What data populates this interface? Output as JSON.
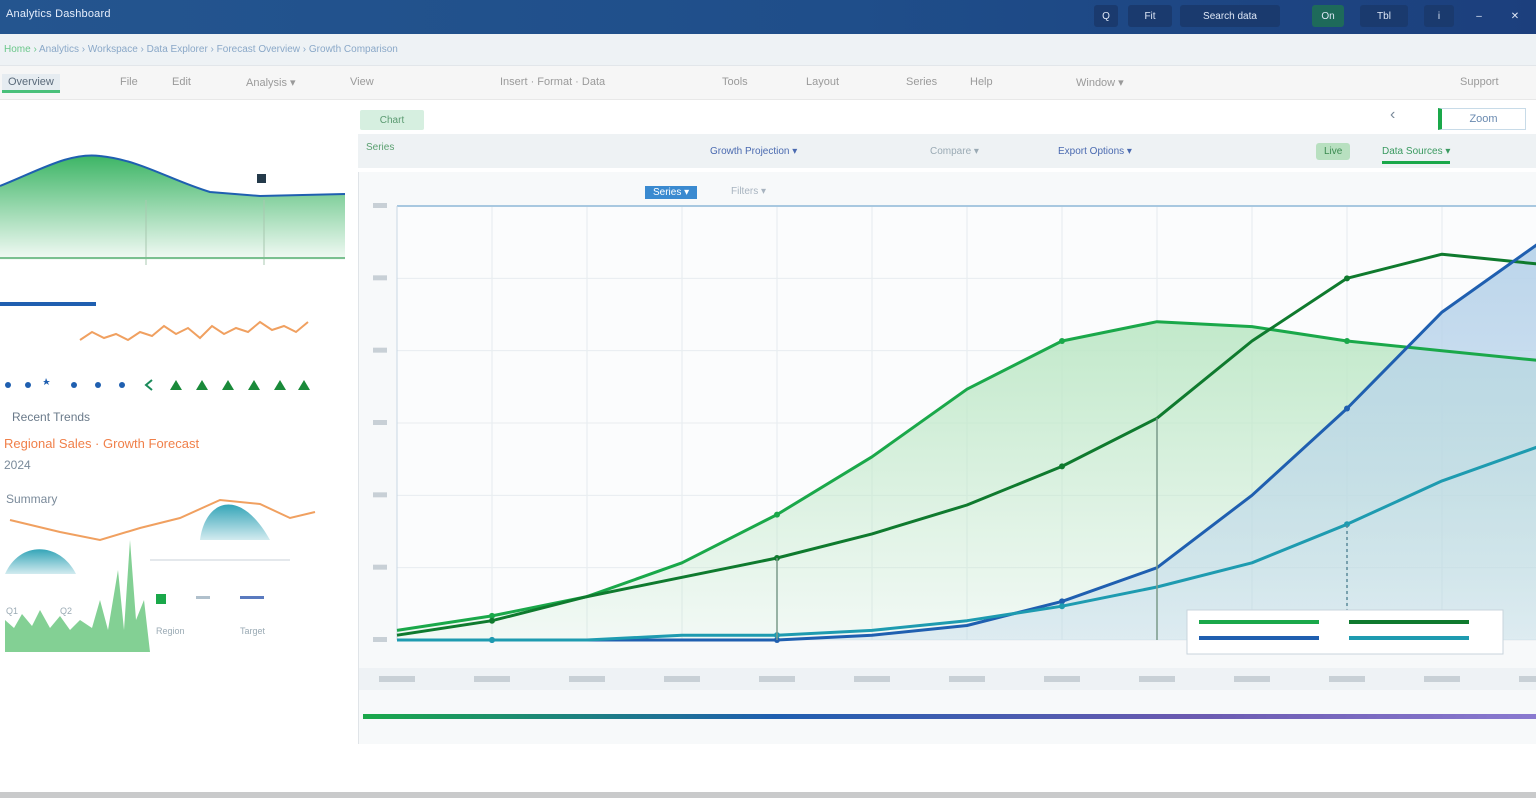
{
  "window": {
    "title": "Analytics Dashboard",
    "buttons": [
      "Q",
      "Fit",
      "Search data",
      "On",
      "Tbl",
      "i",
      "–",
      "✕"
    ]
  },
  "address": {
    "url_prefix": "Home › ",
    "url_tail": "Analytics › Workspace › Data Explorer › Forecast Overview › Growth Comparison"
  },
  "menu": {
    "items": [
      "Overview",
      "File",
      "Edit",
      "Analysis  ▾",
      "View",
      "Insert  ·  Format  ·  Data",
      "Tools",
      "Layout",
      "Series",
      "Help",
      "Window  ▾",
      "Support"
    ]
  },
  "main": {
    "tab_label": "Chart",
    "subtool": {
      "left": "Series",
      "mid": [
        "Growth Projection  ▾",
        "Compare ▾",
        "Export Options ▾"
      ],
      "badge": "Live",
      "right": "Data Sources ▾"
    },
    "legend_chip": "Series ▾",
    "secondary_chip": "Filters ▾",
    "right_actions": [
      "‹",
      "Zoom"
    ]
  },
  "sidebar": {
    "title": "Recent Trends",
    "heading": "Regional Sales · Growth Forecast",
    "heading_sub": "2024",
    "mini_label": "Summary",
    "legend_items": [
      "Q1",
      "Q2",
      "Region",
      "Target"
    ]
  },
  "colors": {
    "green": "#1aa84a",
    "dark_green": "#0f7a2e",
    "blue": "#1f5fb0",
    "teal": "#1e9bb0",
    "light_blue_fill": "#b8d3ea",
    "light_green_fill": "#bfe8c8",
    "orange": "#f0a060",
    "titlebar": "#1f4e8a"
  },
  "chart_data": {
    "type": "line",
    "x": [
      0,
      1,
      2,
      3,
      4,
      5,
      6,
      7,
      8,
      9,
      10,
      11,
      12
    ],
    "series": [
      {
        "values": [
          2,
          5,
          9,
          16,
          26,
          38,
          52,
          62,
          66,
          65,
          62,
          60,
          58
        ]
      },
      {
        "values": [
          1,
          4,
          9,
          13,
          17,
          22,
          28,
          36,
          46,
          62,
          75,
          80,
          78
        ]
      },
      {
        "values": [
          0,
          0,
          0,
          0,
          0,
          1,
          3,
          8,
          15,
          30,
          48,
          68,
          82
        ]
      },
      {
        "values": [
          0,
          0,
          0,
          1,
          1,
          2,
          4,
          7,
          11,
          16,
          24,
          33,
          40
        ]
      }
    ],
    "ylim": [
      0,
      90
    ],
    "grid": true,
    "legend_position": "bottom-right"
  }
}
